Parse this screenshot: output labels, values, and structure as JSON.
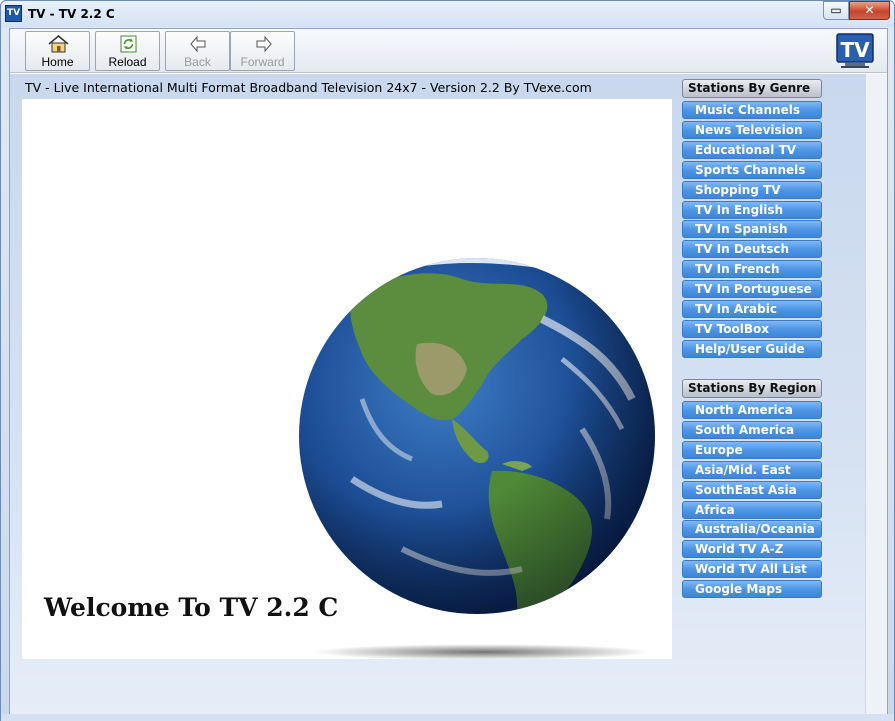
{
  "window": {
    "icon_text": "TV",
    "title": "TV - TV 2.2 C",
    "minimize_glyph": "▭",
    "close_glyph": "✕"
  },
  "toolbar": {
    "buttons": [
      {
        "label": "Home",
        "icon": "home-icon",
        "enabled": true
      },
      {
        "label": "Reload",
        "icon": "reload-icon",
        "enabled": true
      },
      {
        "label": "Back",
        "icon": "back-arrow-icon",
        "enabled": false
      },
      {
        "label": "Forward",
        "icon": "forward-arrow-icon",
        "enabled": false
      }
    ],
    "logo_text": "TV"
  },
  "content": {
    "tagline": "TV - Live International Multi Format Broadband Television 24x7 - Version 2.2 By TVexe.com",
    "welcome": "Welcome To TV 2.2 C",
    "image": "earth-globe"
  },
  "sidebar": {
    "genre_header": "Stations By Genre",
    "genre_items": [
      "Music Channels",
      "News Television",
      "Educational TV",
      "Sports Channels",
      "Shopping TV",
      "TV In English",
      "TV In Spanish",
      "TV In Deutsch",
      "TV In French",
      "TV In Portuguese",
      "TV In Arabic",
      "TV ToolBox",
      "Help/User Guide"
    ],
    "region_header": "Stations By Region",
    "region_items": [
      "North America",
      "South America",
      "Europe",
      "Asia/Mid. East",
      "SouthEast Asia",
      "Africa",
      "Australia/Oceania",
      "World TV A-Z",
      "World TV All List",
      "Google Maps"
    ]
  },
  "colors": {
    "nav_button": "#4b93e3",
    "window_frame": "#c9d9ec",
    "close_button": "#c7432a"
  }
}
